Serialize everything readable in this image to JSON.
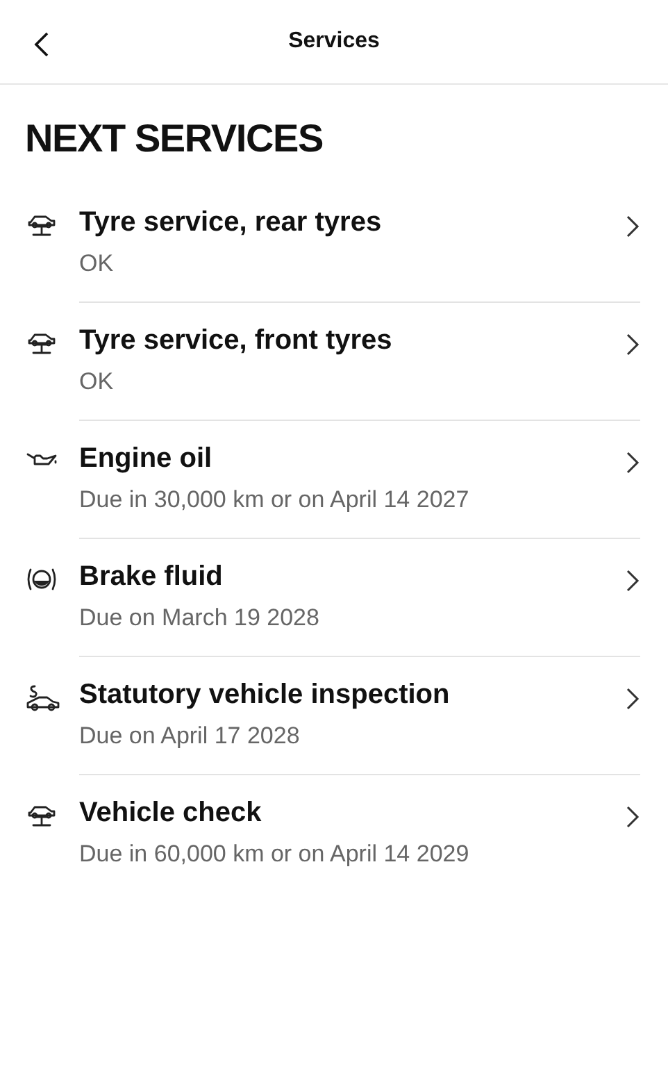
{
  "header": {
    "title": "Services"
  },
  "section_title": "NEXT SERVICES",
  "services": [
    {
      "kind": "lift",
      "title": "Tyre service, rear tyres",
      "detail": "OK"
    },
    {
      "kind": "lift",
      "title": "Tyre service, front tyres",
      "detail": "OK"
    },
    {
      "kind": "oil",
      "title": "Engine oil",
      "detail": "Due in 30,000 km or on April 14 2027"
    },
    {
      "kind": "brake",
      "title": "Brake fluid",
      "detail": "Due on March 19 2028"
    },
    {
      "kind": "inspection",
      "title": "Statutory vehicle inspection",
      "detail": "Due on April 17 2028"
    },
    {
      "kind": "lift",
      "title": "Vehicle check",
      "detail": "Due in 60,000 km or on April 14 2029"
    }
  ]
}
